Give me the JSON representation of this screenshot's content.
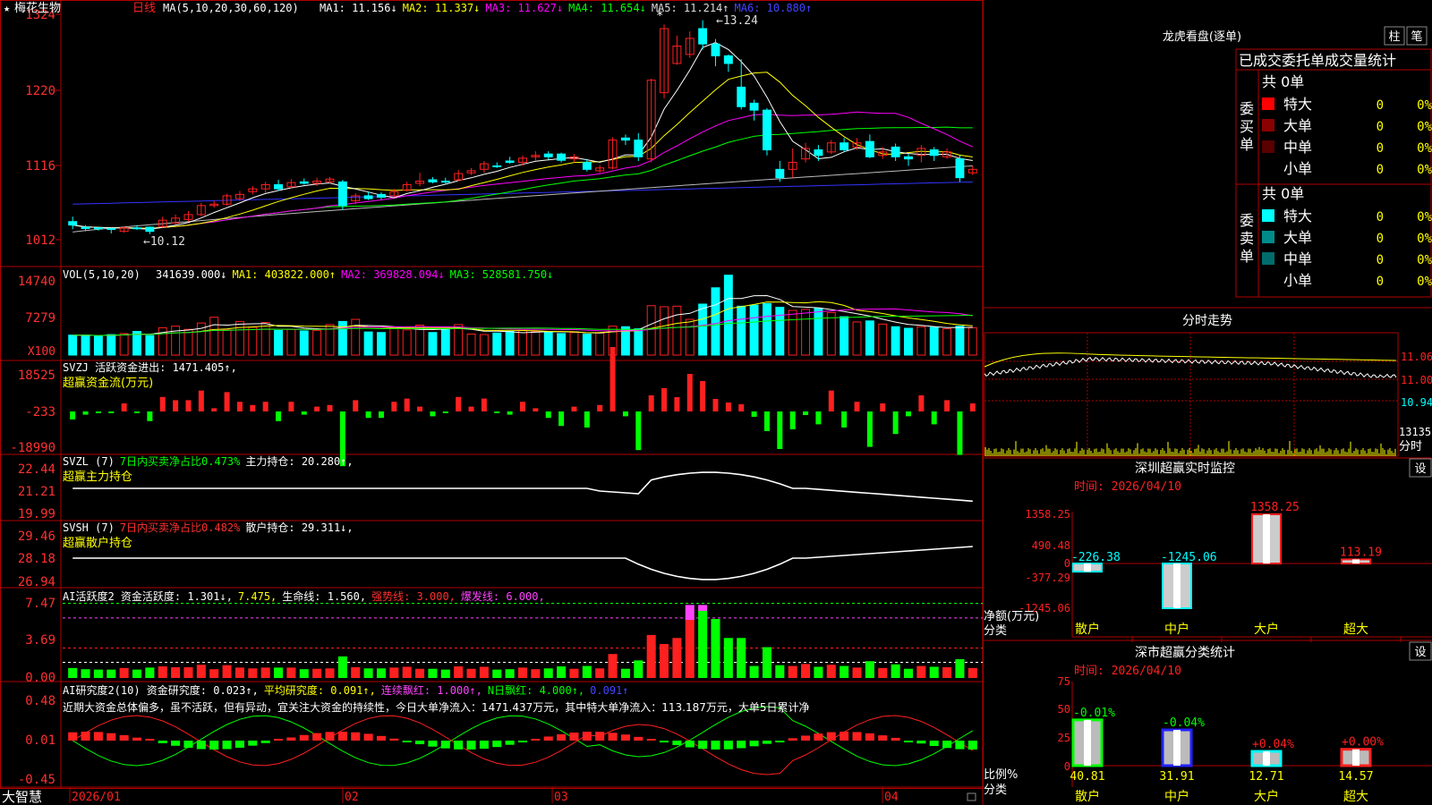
{
  "app": {
    "stock_name": "梅花生物",
    "period": "日线",
    "star": "★",
    "brand": "大智慧"
  },
  "colors": {
    "bg": "#000000",
    "up": "#ff2020",
    "down": "#00ffff",
    "grid": "#8b0000",
    "frame": "#b00000",
    "axis_text": "#ff3030",
    "ma1": "#ffffff",
    "ma2": "#ffff00",
    "ma3": "#ff00ff",
    "ma4": "#00ff00",
    "ma5": "#bbbbbb",
    "ma6": "#3333ff",
    "green": "#00ff00",
    "magenta": "#ff44ff",
    "yellow": "#ffff00",
    "cyan_text": "#00ffff"
  },
  "kline_header": {
    "ma_params": "MA(5,10,20,30,60,120)",
    "items": [
      {
        "text": "MA1: 11.156↓",
        "color": "#ffffff"
      },
      {
        "text": "MA2: 11.337↓",
        "color": "#ffff00"
      },
      {
        "text": "MA3: 11.627↓",
        "color": "#ff00ff"
      },
      {
        "text": "MA4: 11.654↓",
        "color": "#00ff00"
      },
      {
        "text": "MA5: 11.214↑",
        "color": "#dddddd"
      },
      {
        "text": "MA6: 10.880↑",
        "color": "#4444ff"
      }
    ]
  },
  "vol_header": {
    "params": "VOL(5,10,20)",
    "items": [
      {
        "text": "341639.000↓",
        "color": "#ffffff"
      },
      {
        "text": "MA1: 403822.000↑",
        "color": "#ffff00"
      },
      {
        "text": "MA2: 369828.094↓",
        "color": "#ff00ff"
      },
      {
        "text": "MA3: 528581.750↓",
        "color": "#00ff00"
      }
    ]
  },
  "svzj_header": {
    "line1": [
      {
        "text": "SVZJ  活跃资金进出: 1471.405↑,",
        "color": "#ffffff"
      }
    ],
    "line2": {
      "text": "超赢资金流(万元)",
      "color": "#ffff00"
    }
  },
  "svzl_header": {
    "line1": [
      {
        "text": "SVZL (7)",
        "color": "#ffffff"
      },
      {
        "text": "7日内买卖净占比0.473%",
        "color": "#00ff00"
      },
      {
        "text": "主力持仓: 20.280↑,",
        "color": "#ffffff"
      }
    ],
    "line2": {
      "text": "超赢主力持仓",
      "color": "#ffff00"
    }
  },
  "svsh_header": {
    "line1": [
      {
        "text": "SVSH (7)",
        "color": "#ffffff"
      },
      {
        "text": "7日内买卖净占比0.482%",
        "color": "#ff3030"
      },
      {
        "text": "散户持仓: 29.311↓,",
        "color": "#ffffff"
      }
    ],
    "line2": {
      "text": "超赢散户持仓",
      "color": "#ffff00"
    }
  },
  "ai_active_header": {
    "items": [
      {
        "text": "AI活跃度2 资金活跃度: 1.301↓,",
        "color": "#ffffff"
      },
      {
        "text": "7.475,",
        "color": "#ffff00"
      },
      {
        "text": "生命线: 1.560,",
        "color": "#ffffff"
      },
      {
        "text": "强势线: 3.000,",
        "color": "#ff3030"
      },
      {
        "text": "爆发线: 6.000,",
        "color": "#ff44ff"
      }
    ]
  },
  "ai_research_header": {
    "items": [
      {
        "text": "AI研究度2(10) 资金研究度: 0.023↑,",
        "color": "#ffffff"
      },
      {
        "text": "平均研究度: 0.091↑,",
        "color": "#ffff00"
      },
      {
        "text": "连续飘红: 1.000↑,",
        "color": "#ff44ff"
      },
      {
        "text": "N日飘红: 4.000↑,",
        "color": "#00ff00"
      },
      {
        "text": "0.091↑",
        "color": "#4444ff"
      }
    ],
    "comment": "近期大资金总体偏多，虽不活跃，但有异动，宜关注大资金的持续性，今日大单净流入：1471.437万元，其中特大单净流入：113.187万元，大单5日累计净"
  },
  "right_panel": {
    "lhb_title": "龙虎看盘(逐单)",
    "btn_zhu": "柱",
    "btn_bi": "笔",
    "stats_title": "已成交委托单成交量统计",
    "buy_side_label": "委买单",
    "sell_side_label": "委卖单",
    "buy_total": "共 0单",
    "sell_total": "共 0单",
    "buy_rows": [
      {
        "label": "特大",
        "count": "0",
        "pct": "0%",
        "color": "#ff0000"
      },
      {
        "label": "大单",
        "count": "0",
        "pct": "0%",
        "color": "#8b0000"
      },
      {
        "label": "中单",
        "count": "0",
        "pct": "0%",
        "color": "#5a0000"
      },
      {
        "label": "小单",
        "count": "0",
        "pct": "0%",
        "color": ""
      }
    ],
    "sell_rows": [
      {
        "label": "特大",
        "count": "0",
        "pct": "0%",
        "color": "#00ffff"
      },
      {
        "label": "大单",
        "count": "0",
        "pct": "0%",
        "color": "#008b8b"
      },
      {
        "label": "中单",
        "count": "0",
        "pct": "0%",
        "color": "#006d6d"
      },
      {
        "label": "小单",
        "count": "0",
        "pct": "0%",
        "color": ""
      }
    ],
    "fenshi_title": "分时走势",
    "fenshi_ticks": [
      "11.06",
      "11.00",
      "10.94"
    ],
    "fenshi_vol_label": "13135",
    "fenshi_vol_sub": "分时",
    "monitor_title": "深圳超赢实时监控",
    "monitor_btn": "设",
    "monitor_time": "时间: 2026/04/10",
    "monitor_axis_label": "净额(万元)",
    "monitor_axis_sub": "分类",
    "class_title": "深市超赢分类统计",
    "class_btn": "设",
    "class_time": "时间: 2026/04/10",
    "class_axis_label": "比例%",
    "class_axis_sub": "分类"
  },
  "chart_data": [
    {
      "type": "candlestick",
      "name": "price",
      "ylim": [
        1012,
        1324
      ],
      "ticks": [
        "1324",
        "1220",
        "1116",
        "1012"
      ],
      "annotation_high": "13.24",
      "annotation_low": "10.12",
      "date_labels": [
        "2026/01",
        "02",
        "03",
        "04"
      ],
      "candles": [
        [
          10.35,
          10.3,
          10.42,
          10.24
        ],
        [
          10.27,
          10.25,
          10.3,
          10.21
        ],
        [
          10.26,
          10.25,
          10.27,
          10.22
        ],
        [
          10.25,
          10.24,
          10.26,
          10.18
        ],
        [
          10.21,
          10.26,
          10.28,
          10.19
        ],
        [
          10.26,
          10.25,
          10.3,
          10.23
        ],
        [
          10.27,
          10.21,
          10.28,
          10.17
        ],
        [
          10.28,
          10.37,
          10.42,
          10.26
        ],
        [
          10.33,
          10.4,
          10.45,
          10.31
        ],
        [
          10.38,
          10.45,
          10.5,
          10.35
        ],
        [
          10.45,
          10.58,
          10.62,
          10.43
        ],
        [
          10.58,
          10.6,
          10.65,
          10.55
        ],
        [
          10.6,
          10.72,
          10.75,
          10.58
        ],
        [
          10.68,
          10.74,
          10.79,
          10.65
        ],
        [
          10.78,
          10.82,
          10.86,
          10.74
        ],
        [
          10.82,
          10.88,
          10.92,
          10.76
        ],
        [
          10.88,
          10.82,
          10.95,
          10.79
        ],
        [
          10.85,
          10.91,
          10.96,
          10.82
        ],
        [
          10.92,
          10.9,
          10.97,
          10.88
        ],
        [
          10.9,
          10.93,
          10.98,
          10.86
        ],
        [
          10.92,
          10.96,
          10.99,
          10.9
        ],
        [
          10.92,
          10.58,
          10.95,
          10.52
        ],
        [
          10.65,
          10.72,
          10.76,
          10.6
        ],
        [
          10.72,
          10.68,
          10.78,
          10.66
        ],
        [
          10.74,
          10.7,
          10.77,
          10.67
        ],
        [
          10.72,
          10.78,
          10.82,
          10.7
        ],
        [
          10.8,
          10.88,
          10.92,
          10.78
        ],
        [
          10.9,
          10.93,
          11.05,
          10.86
        ],
        [
          10.95,
          10.92,
          10.99,
          10.9
        ],
        [
          10.93,
          10.92,
          10.98,
          10.88
        ],
        [
          10.95,
          11.04,
          11.09,
          10.93
        ],
        [
          11.05,
          11.08,
          11.12,
          11.02
        ],
        [
          11.1,
          11.18,
          11.22,
          11.05
        ],
        [
          11.15,
          11.14,
          11.2,
          11.12
        ],
        [
          11.22,
          11.2,
          11.28,
          11.18
        ],
        [
          11.2,
          11.26,
          11.3,
          11.15
        ],
        [
          11.28,
          11.3,
          11.36,
          11.22
        ],
        [
          11.32,
          11.28,
          11.36,
          11.24
        ],
        [
          11.32,
          11.23,
          11.34,
          11.2
        ],
        [
          11.25,
          11.28,
          11.32,
          11.2
        ],
        [
          11.2,
          11.1,
          11.25,
          11.07
        ],
        [
          11.08,
          11.12,
          11.16,
          11.05
        ],
        [
          11.12,
          11.52,
          11.56,
          11.1
        ],
        [
          11.55,
          11.52,
          11.6,
          11.45
        ],
        [
          11.52,
          11.28,
          11.62,
          11.22
        ],
        [
          11.25,
          12.38,
          12.4,
          11.2
        ],
        [
          12.2,
          13.12,
          13.18,
          12.12
        ],
        [
          12.62,
          12.87,
          13.02,
          12.6
        ],
        [
          12.75,
          12.98,
          13.08,
          12.7
        ],
        [
          13.12,
          12.9,
          13.24,
          12.82
        ],
        [
          12.9,
          12.73,
          12.97,
          12.58
        ],
        [
          12.73,
          12.62,
          12.75,
          12.5
        ],
        [
          12.28,
          12.0,
          12.68,
          11.96
        ],
        [
          12.05,
          11.95,
          12.1,
          11.8
        ],
        [
          11.95,
          11.38,
          11.98,
          11.3
        ],
        [
          11.1,
          10.98,
          11.22,
          10.92
        ],
        [
          11.1,
          11.2,
          11.4,
          10.98
        ],
        [
          11.25,
          11.4,
          11.48,
          11.2
        ],
        [
          11.38,
          11.3,
          11.45,
          11.22
        ],
        [
          11.35,
          11.48,
          11.52,
          11.32
        ],
        [
          11.48,
          11.38,
          11.55,
          11.35
        ],
        [
          11.42,
          11.48,
          11.55,
          11.38
        ],
        [
          11.5,
          11.28,
          11.6,
          11.26
        ],
        [
          11.3,
          11.35,
          11.42,
          11.25
        ],
        [
          11.42,
          11.28,
          11.47,
          11.22
        ],
        [
          11.28,
          11.25,
          11.32,
          11.15
        ],
        [
          11.3,
          11.4,
          11.45,
          11.2
        ],
        [
          11.38,
          11.3,
          11.42,
          11.22
        ],
        [
          11.28,
          11.35,
          11.4,
          11.25
        ],
        [
          11.25,
          10.98,
          11.3,
          10.92
        ],
        [
          11.05,
          11.1,
          11.15,
          11.02
        ]
      ]
    },
    {
      "type": "bar",
      "name": "volume",
      "ylim": [
        0,
        14740
      ],
      "ticks": [
        "14740",
        "7279"
      ],
      "unit_label": "X100",
      "values": [
        3800,
        3800,
        3600,
        3900,
        4100,
        4500,
        3700,
        5200,
        5500,
        4900,
        6100,
        7200,
        4800,
        6400,
        5300,
        6200,
        4700,
        4900,
        4600,
        4700,
        5800,
        6400,
        6800,
        4400,
        4300,
        5100,
        4800,
        5700,
        4300,
        4800,
        5800,
        4000,
        3900,
        4200,
        4500,
        4700,
        4500,
        4400,
        4100,
        4300,
        4000,
        4200,
        5500,
        5400,
        5000,
        9400,
        9200,
        9300,
        6800,
        9700,
        12800,
        15200,
        9300,
        9500,
        9800,
        9100,
        8500,
        8700,
        8900,
        8100,
        7300,
        6300,
        6500,
        5900,
        5400,
        5100,
        5400,
        5300,
        5000,
        5500,
        5200,
        5500,
        5900,
        7600,
        6000,
        5700
      ]
    },
    {
      "type": "bar",
      "name": "svzj",
      "ylim": [
        -18990,
        18525
      ],
      "ticks": [
        "18525",
        "-233",
        "-18990"
      ]
    },
    {
      "type": "line",
      "name": "svzl",
      "ylim": [
        19.99,
        22.44
      ],
      "ticks": [
        "22.44",
        "21.21",
        "19.99"
      ]
    },
    {
      "type": "line",
      "name": "svsh",
      "ylim": [
        26.94,
        29.46
      ],
      "ticks": [
        "29.46",
        "28.18",
        "26.94"
      ]
    },
    {
      "type": "bar",
      "name": "ai_active",
      "ylim": [
        0,
        7.47
      ],
      "ticks": [
        "7.47",
        "3.69",
        "0.00"
      ]
    },
    {
      "type": "bar",
      "name": "ai_research",
      "ylim": [
        -0.45,
        0.48
      ],
      "ticks": [
        "0.48",
        "0.01",
        "-0.45"
      ]
    },
    {
      "type": "bar",
      "name": "shenzhen_monitor",
      "ylim": [
        -1245.06,
        1358.25
      ],
      "ticks": [
        "1358.25",
        "490.48",
        "0",
        "-377.29",
        "-1245.06"
      ],
      "categories": [
        "散户",
        "中户",
        "大户",
        "超大"
      ],
      "values": [
        -226.38,
        -1245.06,
        1358.25,
        113.19
      ],
      "value_labels": [
        "-226.38",
        "-1245.06",
        "1358.25",
        "113.19"
      ]
    },
    {
      "type": "bar",
      "name": "shenzhen_class",
      "ylim": [
        0,
        75
      ],
      "ticks": [
        "75",
        "50",
        "25",
        "0"
      ],
      "categories": [
        "散户",
        "中户",
        "大户",
        "超大"
      ],
      "values": [
        40.81,
        31.91,
        12.71,
        14.57
      ],
      "value_labels": [
        "40.81",
        "31.91",
        "12.71",
        "14.57"
      ],
      "change_labels": [
        "-0.01%",
        "-0.04%",
        "+0.04%",
        "+0.00%"
      ]
    }
  ]
}
